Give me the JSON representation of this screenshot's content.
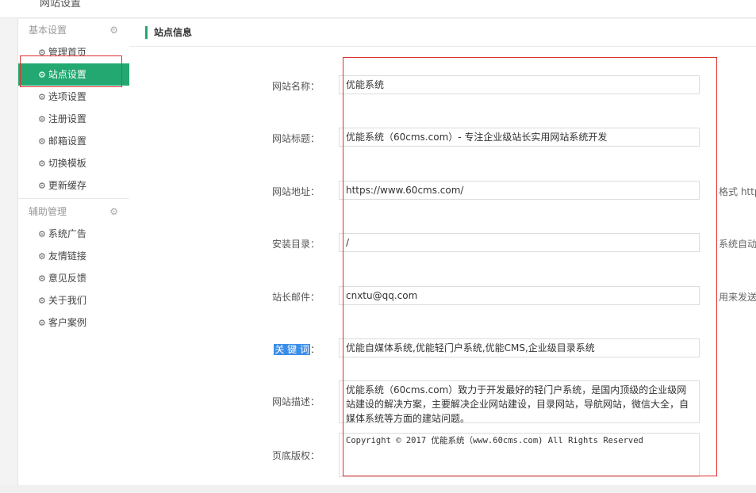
{
  "topbar": {
    "cut_text": "网站设置"
  },
  "sidebar": {
    "groups": [
      {
        "title": "基本设置",
        "items": [
          "管理首页",
          "站点设置",
          "选项设置",
          "注册设置",
          "邮箱设置",
          "切换模板",
          "更新缓存"
        ]
      },
      {
        "title": "辅助管理",
        "items": [
          "系统广告",
          "友情链接",
          "意见反馈",
          "关于我们",
          "客户案例"
        ]
      }
    ],
    "active_item": "站点设置"
  },
  "main": {
    "title": "站点信息",
    "fields": [
      {
        "label": "网站名称：",
        "value": "优能系统",
        "hint": ""
      },
      {
        "label": "网站标题：",
        "value": "优能系统（60cms.com）- 专注企业级站长实用网站系统开发",
        "hint": ""
      },
      {
        "label": "网站地址：",
        "value": "https://www.60cms.com/",
        "hint": "格式 http"
      },
      {
        "label": "安装目录：",
        "value": "/",
        "hint": "系统自动"
      },
      {
        "label": "站长邮件：",
        "value": "cnxtu@qq.com",
        "hint": "用来发送"
      },
      {
        "label_selected": "关 键 词",
        "label_suffix": "：",
        "value": "优能自媒体系统,优能轻门户系统,优能CMS,企业级目录系统",
        "hint": ""
      },
      {
        "label": "网站描述：",
        "value": "优能系统（60cms.com）致力于开发最好的轻门户系统，是国内顶级的企业级网站建设的解决方案，主要解决企业网站建设，目录网站，导航网站，微信大全，自媒体系统等方面的建站问题。",
        "hint": ""
      },
      {
        "label": "页底版权：",
        "value": "Copyright © 2017  优能系统（www.60cms.com)  All Rights Reserved",
        "hint": ""
      }
    ]
  },
  "colors": {
    "accent": "#23a871",
    "highlight_frame": "#e03030",
    "selection": "#3b8ee8"
  },
  "icons": {
    "nav": "gear-icon",
    "group": "gear-icon"
  }
}
